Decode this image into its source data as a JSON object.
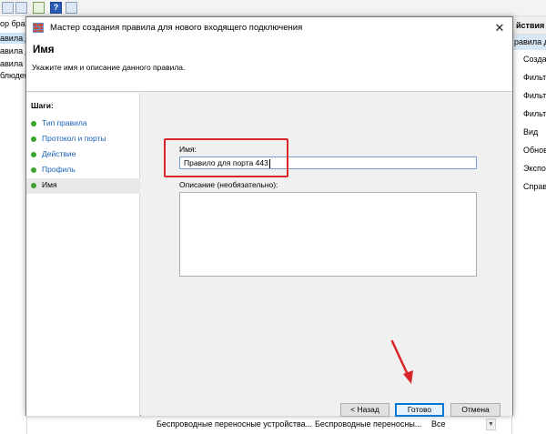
{
  "background": {
    "left_items": [
      {
        "label": "ор бра",
        "selected": false
      },
      {
        "label": "авила д",
        "selected": true
      },
      {
        "label": "авила д",
        "selected": false
      },
      {
        "label": "авила б",
        "selected": false
      },
      {
        "label": "блюден",
        "selected": false
      }
    ],
    "actions_header": "йствия",
    "actions_subheader": "равила д",
    "actions": [
      "Создат",
      "Фильт",
      "Фильт",
      "Фильт",
      "Вид",
      "Обнов",
      "Экспо",
      "Справ"
    ],
    "bottom_row": {
      "col1": "Беспроводные переносные устройства...",
      "col2": "Беспроводные переносны...",
      "col3": "Все"
    }
  },
  "dialog": {
    "title": "Мастер создания правила для нового входящего подключения",
    "close_glyph": "✕",
    "header": {
      "title": "Имя",
      "subtitle": "Укажите имя и описание данного правила."
    },
    "steps_header": "Шаги:",
    "steps": [
      {
        "label": "Тип правила",
        "active": false
      },
      {
        "label": "Протокол и порты",
        "active": false
      },
      {
        "label": "Действие",
        "active": false
      },
      {
        "label": "Профиль",
        "active": false
      },
      {
        "label": "Имя",
        "active": true
      }
    ],
    "form": {
      "name_label": "Имя:",
      "name_value": "Правило для порта 443",
      "description_label": "Описание (необязательно):",
      "description_value": ""
    },
    "buttons": {
      "back": "< Назад",
      "finish": "Готово",
      "cancel": "Отмена"
    }
  },
  "colors": {
    "highlight": "#d9262b",
    "step_dot": "#3aa42f",
    "link": "#1a62b8"
  }
}
